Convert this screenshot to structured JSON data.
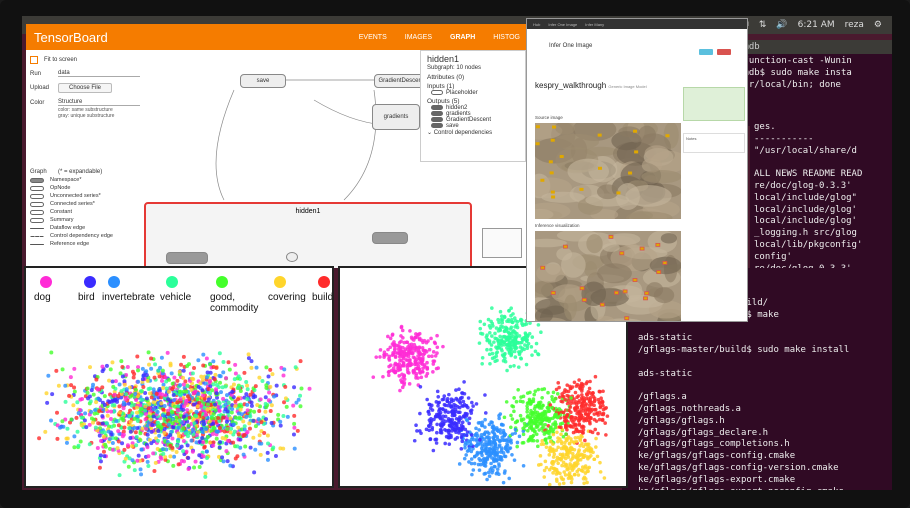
{
  "topbar": {
    "items": [
      "✉",
      "⇅",
      "🔊",
      "6:21 AM",
      "reza",
      "⚙"
    ]
  },
  "terminal1": {
    "lines": [
      "imdb",
      "-function-cast -Wunin",
      "imdb$ sudo make insta",
      "usr/local/bin; done"
    ]
  },
  "terminal2": {
    "lines": [
      "ges.",
      "-----------",
      "\"/usr/local/share/d",
      "",
      "ALL NEWS README READ",
      "re/doc/glog-0.3.3'",
      "local/include/glog\"",
      "local/include/glog'",
      "local/include/glog'",
      "_logging.h src/glog",
      "local/lib/pkgconfig'",
      "config'",
      "re/doc/glog-0.3.3'"
    ]
  },
  "terminal3": {
    "lines": [
      "master/build'",
      "ads/gflags-master/build/",
      "/gflags-master/build$ make",
      "",
      "ads-static",
      "/gflags-master/build$ sudo make install",
      "",
      "ads-static",
      "",
      "/gflags.a",
      "/gflags_nothreads.a",
      "/gflags/gflags.h",
      "/gflags/gflags_declare.h",
      "/gflags/gflags_completions.h",
      "ke/gflags/gflags-config.cmake",
      "ke/gflags/gflags-config-version.cmake",
      "ke/gflags/gflags-export.cmake",
      "ke/gflags/gflags-export-noconfig.cmake"
    ]
  },
  "tensorboard": {
    "title": "TensorBoard",
    "nav": [
      "EVENTS",
      "IMAGES",
      "GRAPH",
      "HISTOG"
    ],
    "fit_label": "Fit to screen",
    "run_label": "Run",
    "run_value": "data",
    "upload_label": "Upload",
    "upload_button": "Choose File",
    "color_label": "Color",
    "color_value": "Structure",
    "color_note": "color: same substructure\ngray: unique substructure",
    "graph_label": "Graph",
    "graph_note": "(* = expandable)",
    "legend": [
      "Namespace*",
      "OpNode",
      "Unconnected series*",
      "Connected series*",
      "Constant",
      "Summary",
      "Dataflow edge",
      "Control dependency edge",
      "Reference edge"
    ],
    "nodes": {
      "save": "save",
      "gradient_descent": "GradientDescent",
      "gradients": "gradients",
      "hidden1": "hidden1"
    },
    "info": {
      "name": "hidden1",
      "subgraph": "Subgraph: 10 nodes",
      "attributes": "Attributes (0)",
      "inputs": "Inputs (1)",
      "input_items": [
        "Placeholder"
      ],
      "outputs": "Outputs (5)",
      "output_items": [
        "hidden2",
        "gradients",
        "GradientDescent",
        "save"
      ],
      "control": "Control dependencies"
    }
  },
  "embedding": {
    "categories": [
      {
        "label": "dog",
        "color": "#ff2bd6"
      },
      {
        "label": "bird",
        "color": "#3a2bff"
      },
      {
        "label": "invertebrate",
        "color": "#2b8fff"
      },
      {
        "label": "vehicle",
        "color": "#2bff9a"
      },
      {
        "label": "good,\ncommodity",
        "color": "#44ff2b"
      },
      {
        "label": "covering",
        "color": "#ffd52b"
      },
      {
        "label": "building",
        "color": "#ff2b2b"
      }
    ]
  },
  "infer": {
    "nav": [
      "Hub",
      "Infer One Image",
      "Infer Many"
    ],
    "title": "Infer One Image",
    "model_name": "kespry_walkthrough",
    "model_sub": "Generic Image Model",
    "source_label": "Source image",
    "viz_label": "Inference visualization",
    "notes_label": "Notes",
    "colors": {
      "blue": "#5bc0de",
      "red": "#d9534f"
    }
  }
}
